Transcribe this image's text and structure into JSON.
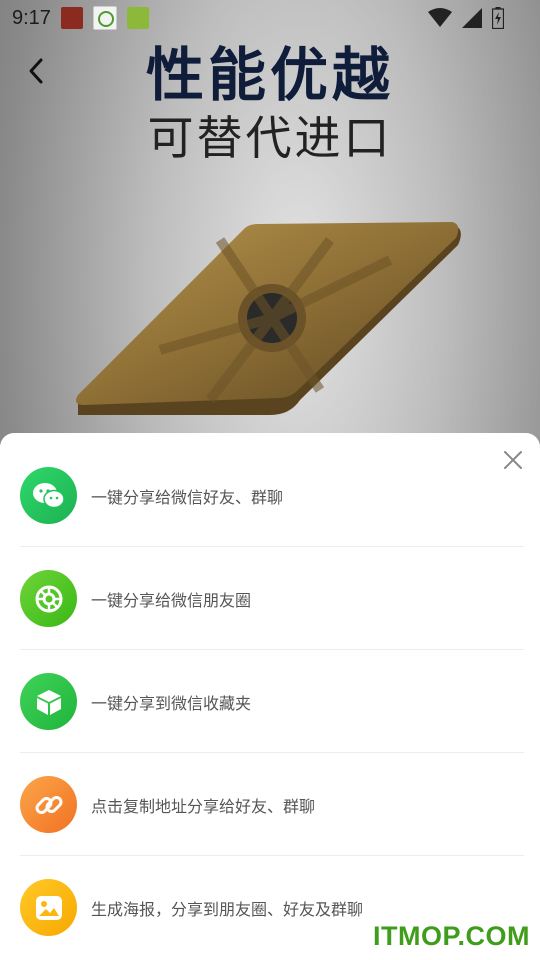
{
  "statusbar": {
    "time": "9:17",
    "icons": [
      "notification-app-icon",
      "notification-app-icon",
      "notification-app-icon",
      "wifi-icon",
      "cell-signal-icon",
      "battery-icon"
    ]
  },
  "banner": {
    "headline": "性能优越",
    "subheadline": "可替代进口"
  },
  "share_sheet": {
    "items": [
      {
        "label": "一键分享给微信好友、群聊",
        "icon": "wechat-icon",
        "color": "#21c35c"
      },
      {
        "label": "一键分享给微信朋友圈",
        "icon": "moments-icon",
        "color": "#5ac51f"
      },
      {
        "label": "一键分享到微信收藏夹",
        "icon": "cube-icon",
        "color": "#2fc845"
      },
      {
        "label": "点击复制地址分享给好友、群聊",
        "icon": "link-icon",
        "color": "#fb8a34"
      },
      {
        "label": "生成海报，分享到朋友圈、好友及群聊",
        "icon": "image-icon",
        "color": "#fdb607"
      }
    ]
  },
  "watermark": "ITMOP.COM"
}
